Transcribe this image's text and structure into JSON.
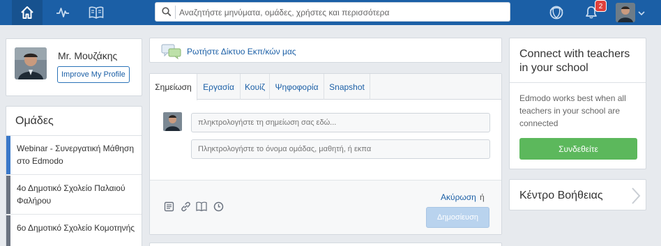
{
  "search": {
    "placeholder": "Αναζητήστε μηνύματα, ομάδες, χρήστες και περισσότερα"
  },
  "nav": {
    "notifications_count": "2"
  },
  "profile": {
    "name": "Mr. Μουζάκης",
    "improve_label": "Improve My Profile"
  },
  "groups": {
    "title": "Ομάδες",
    "items": [
      {
        "label": "Webinar - Συνεργατική Μάθηση στο Edmodo",
        "color": "#3a78c9"
      },
      {
        "label": "4ο Δημοτικό Σχολείο Παλαιού Φαλήρου",
        "color": "#6b7380"
      },
      {
        "label": "6ο Δημοτικό Σχολείο Κομοτηνής",
        "color": "#6b7380"
      }
    ]
  },
  "ask": {
    "label": "Ρωτήστε Δίκτυο Εκπ/κών μας"
  },
  "composer": {
    "tabs": [
      "Σημείωση",
      "Εργασία",
      "Κουίζ",
      "Ψηφοφορία",
      "Snapshot"
    ],
    "note_placeholder": "πληκτρολογήστε τη σημείωση σας εδώ...",
    "recipient_placeholder": "Πληκτρολογήστε το όνομα ομάδας, μαθητή, ή εκπα",
    "cancel_label": "Ακύρωση",
    "or_label": "ή",
    "post_label": "Δημοσίευση"
  },
  "connect": {
    "title": "Connect with teachers in your school",
    "body": "Edmodo works best when all teachers in your school are connected",
    "button": "Συνδεθείτε"
  },
  "help": {
    "label": "Κέντρο Βοήθειας"
  },
  "colors": {
    "brand": "#1b5fa6",
    "success": "#5cb85c",
    "badge": "#e0413c"
  }
}
